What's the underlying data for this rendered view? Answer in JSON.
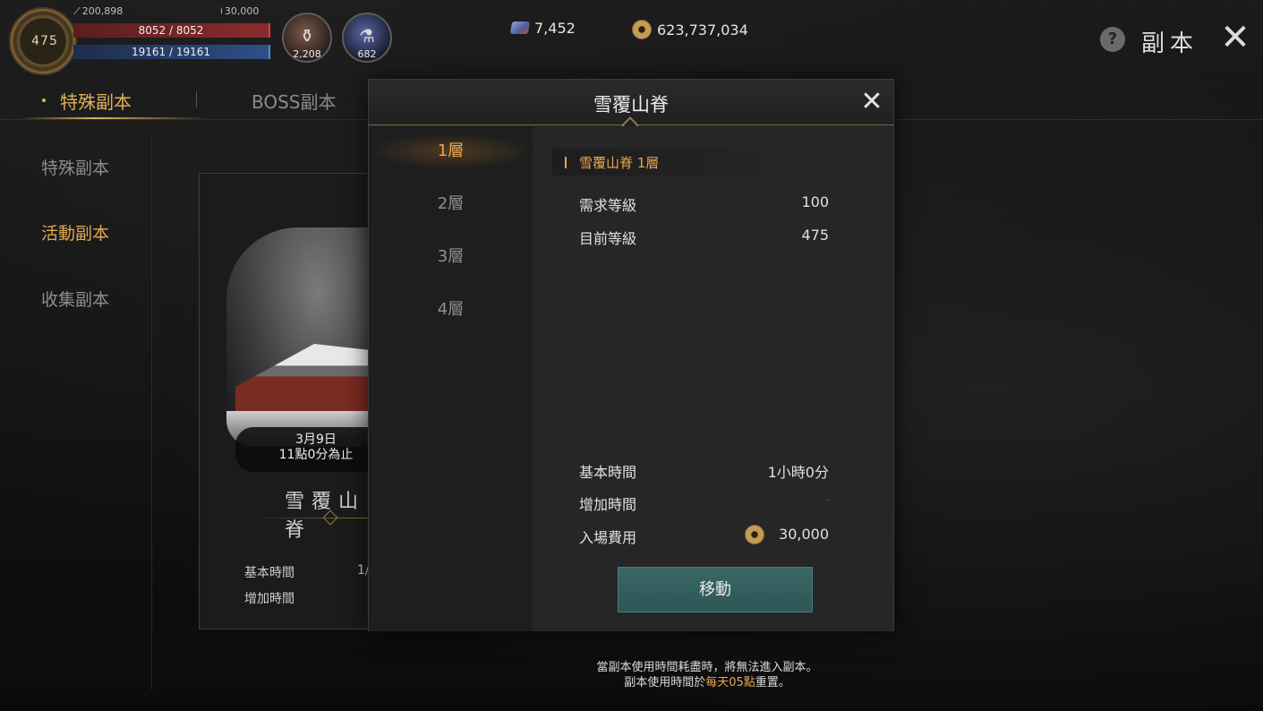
{
  "hud": {
    "level": "475",
    "attack_power": "200,898",
    "stat_two": "30,000",
    "hp": "8052 / 8052",
    "mp": "19161 / 19161",
    "potion_red_count": "2,208",
    "potion_blue_count": "682",
    "gems": "7,452",
    "gold": "623,737,034",
    "page_title": "副本"
  },
  "tabs": [
    {
      "label": "特殊副本"
    },
    {
      "label": "BOSS副本"
    }
  ],
  "side_menu": [
    {
      "label": "特殊副本"
    },
    {
      "label": "活動副本"
    },
    {
      "label": "收集副本"
    }
  ],
  "card": {
    "date_line1": "3月9日",
    "date_line2": "11點0分為止",
    "name": "雪覆山脊",
    "base_time_label": "基本時間",
    "base_time_value": "1/",
    "add_time_label": "增加時間"
  },
  "modal": {
    "title": "雪覆山脊",
    "floors": [
      "1層",
      "2層",
      "3層",
      "4層"
    ],
    "section_title": "雪覆山脊 1層",
    "req_level_label": "需求等級",
    "req_level_value": "100",
    "cur_level_label": "目前等級",
    "cur_level_value": "475",
    "base_time_label": "基本時間",
    "base_time_value": "1小時0分",
    "add_time_label": "增加時間",
    "add_time_value": "-",
    "fee_label": "入場費用",
    "fee_value": "30,000",
    "move_label": "移動"
  },
  "footer": {
    "line1": "當副本使用時間耗盡時，將無法進入副本。",
    "line2_pre": "副本使用時間於",
    "line2_hl": "每天05點",
    "line2_post": "重置。"
  },
  "colors": {
    "accent": "#e0a851",
    "button": "#2d5656"
  }
}
